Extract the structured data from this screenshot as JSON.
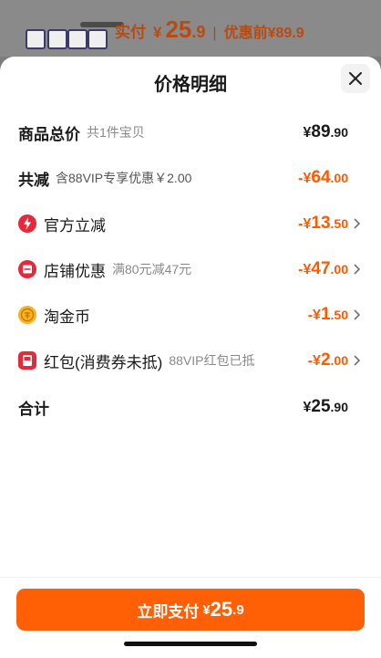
{
  "header": {
    "pay_label": "实付",
    "pay_yen": "¥",
    "pay_int": "25",
    "pay_dec": ".9",
    "separator": "|",
    "orig_label": "优惠前¥89.9"
  },
  "sheet": {
    "title": "价格明细",
    "close_icon": "close-icon"
  },
  "rows": {
    "total_goods": {
      "label": "商品总价",
      "sub": "共1件宝贝",
      "prefix": "¥",
      "int": "89",
      "dec": ".90"
    },
    "total_discount": {
      "label": "共减",
      "sub": "含88VIP专享优惠￥2.00",
      "prefix": "-¥",
      "int": "64",
      "dec": ".00"
    },
    "official": {
      "label": "官方立减",
      "sub": "",
      "prefix": "-¥",
      "int": "13",
      "dec": ".50",
      "icon": "lightning-icon"
    },
    "store": {
      "label": "店铺优惠",
      "sub": "满80元减47元",
      "prefix": "-¥",
      "int": "47",
      "dec": ".00",
      "icon": "store-coupon-icon"
    },
    "coin": {
      "label": "淘金币",
      "sub": "",
      "prefix": "-¥",
      "int": "1",
      "dec": ".50",
      "icon": "coin-icon"
    },
    "redpacket": {
      "label": "红包(消费券未抵)",
      "sub": "88VIP红包已抵",
      "prefix": "-¥",
      "int": "2",
      "dec": ".00",
      "icon": "red-packet-icon"
    },
    "sum": {
      "label": "合计",
      "prefix": "¥",
      "int": "25",
      "dec": ".90"
    }
  },
  "footer": {
    "pay_button_label": "立即支付",
    "yen": "¥",
    "int": "25",
    "dec": ".9"
  },
  "colors": {
    "accent": "#ff5f05",
    "discount": "#ff5a00",
    "text": "#1a1a1a"
  }
}
